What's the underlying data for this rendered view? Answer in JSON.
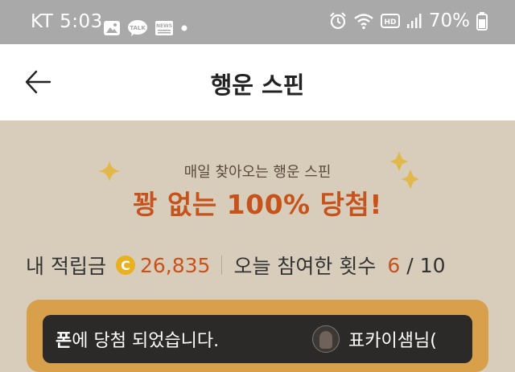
{
  "status_bar": {
    "carrier_time": "KT 5:03",
    "battery_percent": "70%",
    "icons": [
      "gallery-icon",
      "talk-icon",
      "news-icon",
      "dot-icon",
      "alarm-icon",
      "wifi-icon",
      "hd-icon",
      "signal-icon",
      "battery-icon"
    ],
    "talk_label": "TALK",
    "news_label": "NEWS",
    "hd_label": "HD"
  },
  "appbar": {
    "title": "행운 스핀",
    "back_icon": "arrow-left-icon"
  },
  "promo": {
    "subtitle": "매일 찾아오는 행운 스핀",
    "headline": "꽝 없는 100% 당첨!",
    "accent_color": "#c6531c"
  },
  "stats": {
    "points_label": "내 적립금",
    "coin_symbol": "C",
    "points_value": "26,835",
    "count_label": "오늘 참여한 횟수",
    "count_current": "6",
    "count_separator": "/",
    "count_max": "10"
  },
  "ticker": {
    "message_bold": "폰",
    "message_rest": "에 당첨 되었습니다.",
    "user_name": "표카이샘님("
  }
}
